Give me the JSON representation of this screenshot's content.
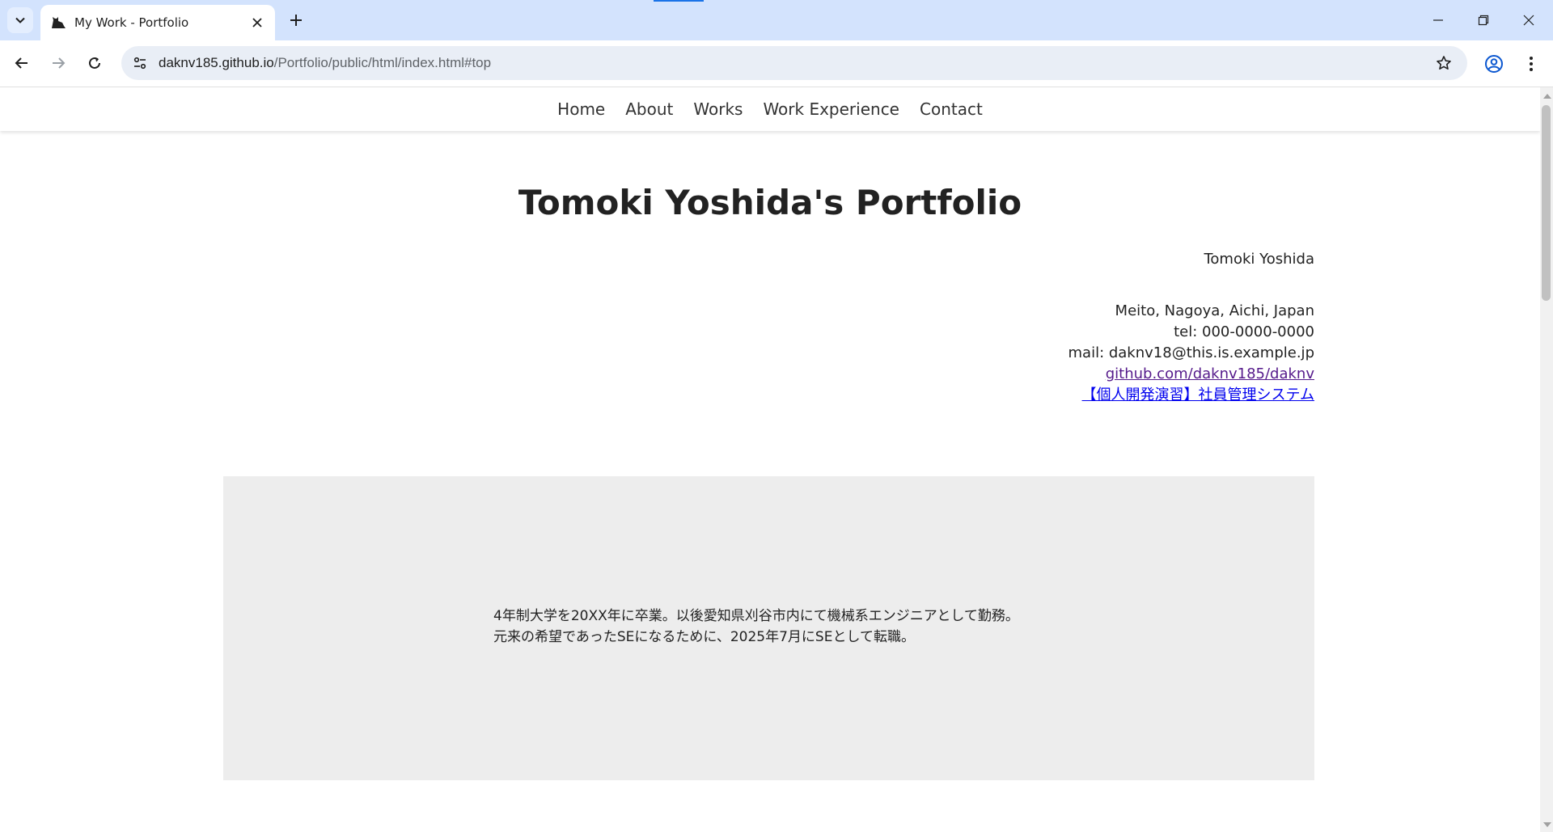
{
  "browser": {
    "tab_title": "My Work - Portfolio",
    "url_host": "daknv185.github.io",
    "url_path": "/Portfolio/public/html/index.html#top"
  },
  "site": {
    "nav": [
      "Home",
      "About",
      "Works",
      "Work Experience",
      "Contact"
    ],
    "title": "Tomoki Yoshida's Portfolio",
    "contact": {
      "name": "Tomoki Yoshida",
      "address": "Meito, Nagoya, Aichi, Japan",
      "tel": "tel: 000-0000-0000",
      "mail": "mail: daknv18@this.is.example.jp",
      "github_link": "github.com/daknv185/daknv",
      "project_link": "【個人開発演習】社員管理システム"
    },
    "about": {
      "line1": "4年制大学を20XX年に卒業。以後愛知県刈谷市内にて機械系エンジニアとして勤務。",
      "line2": "元来の希望であったSEになるために、2025年7月にSEとして転職。"
    }
  },
  "colors": {
    "tabbar_bg": "#d3e3fd",
    "omnibox_bg": "#e9eef6",
    "about_bg": "#ededed",
    "visited_link": "#551a8b",
    "link": "#0000ee"
  }
}
